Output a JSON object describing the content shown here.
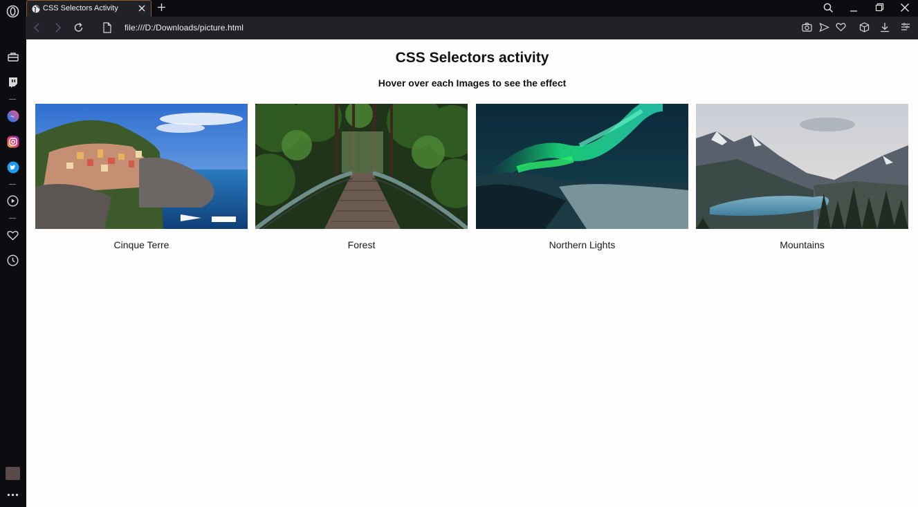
{
  "browser": {
    "tab_title": "CSS Selectors Activity",
    "url": "file:///D:/Downloads/picture.html",
    "accent": "#8e5f2e",
    "sidebar_icons": [
      "opera-logo-icon",
      "briefcase-icon",
      "twitch-icon",
      "messenger-icon",
      "instagram-icon",
      "twitter-icon",
      "player-icon",
      "heart-icon",
      "history-icon",
      "extension-icon",
      "more-icon"
    ],
    "toolbar_icons": [
      "snapshot-icon",
      "send-icon",
      "heart-icon",
      "cube-icon",
      "download-icon",
      "menu-icon"
    ]
  },
  "page": {
    "title": "CSS Selectors activity",
    "subtitle": "Hover over each Images to see the effect",
    "images": [
      {
        "caption": "Cinque Terre"
      },
      {
        "caption": "Forest"
      },
      {
        "caption": "Northern Lights"
      },
      {
        "caption": "Mountains"
      }
    ]
  }
}
